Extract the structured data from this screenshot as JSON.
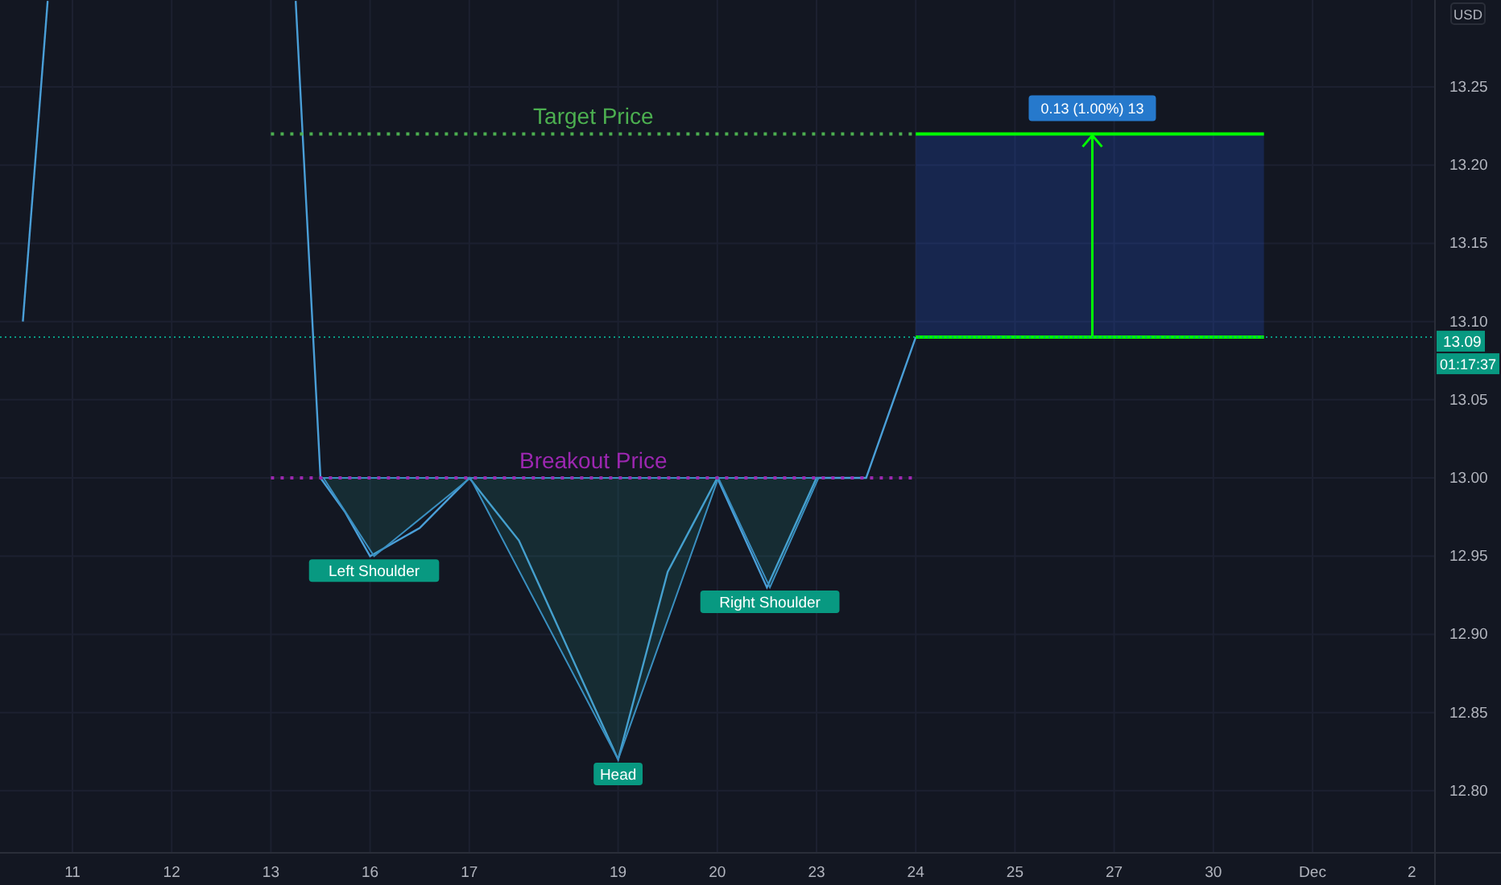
{
  "chart_data": {
    "type": "line",
    "grid": true,
    "ylim": [
      12.7603,
      13.3056
    ],
    "yticks": [
      {
        "value": 13.25,
        "label": "13.25"
      },
      {
        "value": 13.2,
        "label": "13.20"
      },
      {
        "value": 13.15,
        "label": "13.15"
      },
      {
        "value": 13.1,
        "label": "13.10"
      },
      {
        "value": 13.05,
        "label": "13.05"
      },
      {
        "value": 13.0,
        "label": "13.00"
      },
      {
        "value": 12.95,
        "label": "12.95"
      },
      {
        "value": 12.9,
        "label": "12.90"
      },
      {
        "value": 12.85,
        "label": "12.85"
      },
      {
        "value": 12.8,
        "label": "12.80"
      }
    ],
    "categories": [
      null,
      null,
      "11",
      null,
      null,
      null,
      "12",
      null,
      null,
      null,
      "13",
      null,
      null,
      null,
      "16",
      null,
      null,
      null,
      "17",
      null,
      null,
      null,
      null,
      null,
      "19",
      null,
      null,
      null,
      "20",
      null,
      null,
      null,
      "23",
      null,
      null,
      null,
      "24",
      null,
      null,
      null,
      "25",
      null,
      null,
      null,
      "27",
      null,
      null,
      null,
      "30",
      null,
      null,
      null,
      "Dec",
      null,
      null,
      null,
      "2"
    ],
    "series": [
      {
        "color": "#4a9fd8",
        "values": [
          13.1,
          13.305,
          null,
          null,
          null,
          null,
          null,
          null,
          null,
          null,
          null,
          13.305,
          13.0,
          12.978,
          12.95,
          12.959,
          12.968,
          12.984,
          13.0,
          12.98,
          12.96,
          12.925,
          12.89,
          12.855,
          12.82,
          12.88,
          12.94,
          12.97,
          13.0,
          12.965,
          12.93,
          12.965,
          13.0,
          13.0,
          13.0,
          13.045,
          13.09,
          null,
          null,
          null,
          null,
          null,
          null,
          null,
          null,
          null,
          null,
          null,
          null,
          null,
          null,
          null,
          null,
          null,
          null,
          null,
          null
        ]
      }
    ]
  },
  "drawings": [
    {
      "kind": "level",
      "text": "Target Price",
      "color": "#4caf50"
    },
    {
      "kind": "level",
      "text": "Breakout Price",
      "color": "#9c27b0"
    },
    {
      "kind": "pattern"
    },
    {
      "kind": "tag",
      "text": "Left Shoulder"
    },
    {
      "kind": "tag",
      "text": "Head"
    },
    {
      "kind": "tag",
      "text": "Right Shoulder"
    },
    {
      "kind": "measure",
      "text": "0.13 (1.00%) 13"
    }
  ],
  "price_axis": {
    "currency": "USD",
    "last_price": "13.09",
    "countdown": "01:17:37"
  }
}
